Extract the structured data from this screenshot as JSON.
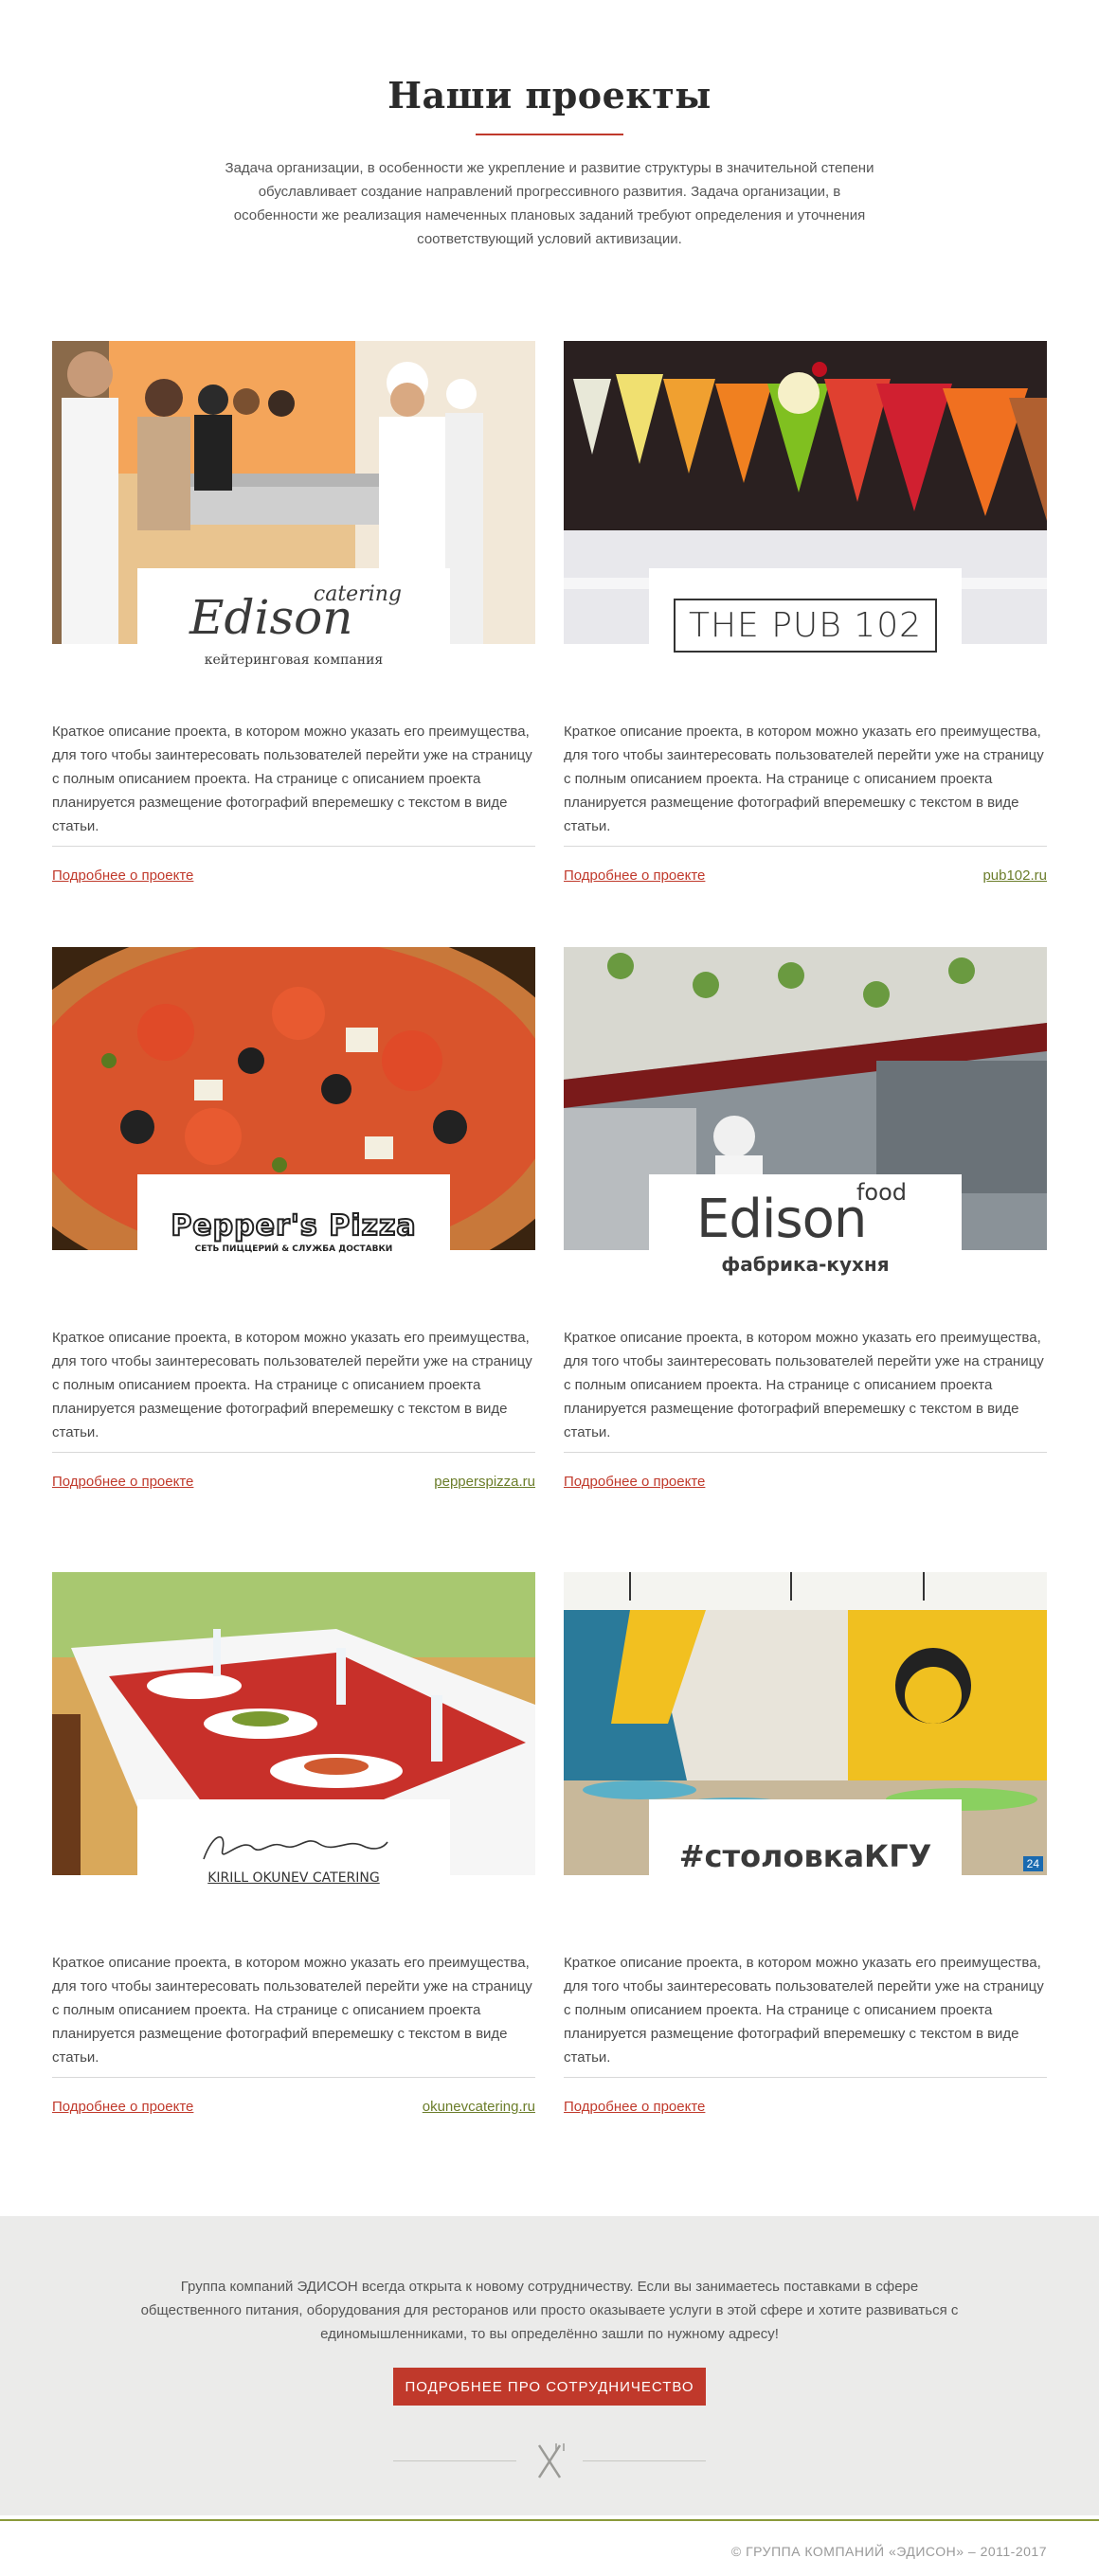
{
  "intro": {
    "title": "Наши проекты",
    "text": "Задача организации, в особенности же укрепление и развитие структуры в значительной степени обуславливает создание направлений прогрессивного развития. Задача организации, в особенности же реализация намеченных плановых заданий требуют определения и уточнения соответствующий условий активизации."
  },
  "projects": [
    {
      "logo_main": "Edison",
      "logo_super": "catering",
      "logo_sub": "кейтеринговая компания",
      "description": "Краткое описание проекта, в котором можно указать его преимущества, для того чтобы заинтересовать пользователей перейти уже на страницу с полным описанием проекта. На странице с описанием проекта планируется размещение фотографий вперемешку с текстом в виде статьи.",
      "more_label": "Подробнее о проекте",
      "site": ""
    },
    {
      "logo_main": "THE PUB 102",
      "description": "Краткое описание проекта, в котором можно указать его преимущества, для того чтобы заинтересовать пользователей перейти уже на страницу с полным описанием проекта. На странице с описанием проекта планируется размещение фотографий вперемешку с текстом в виде статьи.",
      "more_label": "Подробнее о проекте",
      "site": "pub102.ru"
    },
    {
      "logo_main": "Pepper's Pizza",
      "logo_sub": "СЕТЬ ПИЦЦЕРИЙ & СЛУЖБА ДОСТАВКИ",
      "description": "Краткое описание проекта, в котором можно указать его преимущества, для того чтобы заинтересовать пользователей перейти уже на страницу с полным описанием проекта. На странице с описанием проекта планируется размещение фотографий вперемешку с текстом в виде статьи.",
      "more_label": "Подробнее о проекте",
      "site": "pepperspizza.ru"
    },
    {
      "logo_main": "Edison",
      "logo_super": "food",
      "logo_sub": "фабрика-кухня",
      "description": "Краткое описание проекта, в котором можно указать его преимущества, для того чтобы заинтересовать пользователей перейти уже на страницу с полным описанием проекта. На странице с описанием проекта планируется размещение фотографий вперемешку с текстом в виде статьи.",
      "more_label": "Подробнее о проекте",
      "site": ""
    },
    {
      "logo_sub": "KIRILL OKUNEV CATERING",
      "description": "Краткое описание проекта, в котором можно указать его преимущества, для того чтобы заинтересовать пользователей перейти уже на страницу с полным описанием проекта. На странице с описанием проекта планируется размещение фотографий вперемешку с текстом в виде статьи.",
      "more_label": "Подробнее о проекте",
      "site": "okunevcatering.ru"
    },
    {
      "logo_main": "#столовкаКГУ",
      "photo_badge": "24",
      "description": "Краткое описание проекта, в котором можно указать его преимущества, для того чтобы заинтересовать пользователей перейти уже на страницу с полным описанием проекта. На странице с описанием проекта планируется размещение фотографий вперемешку с текстом в виде статьи.",
      "more_label": "Подробнее о проекте",
      "site": ""
    }
  ],
  "cooperation": {
    "text": "Группа компаний ЭДИСОН всегда открыта к новому сотрудничеству. Если вы занимаетесь поставками в сфере общественного питания, оборудования для ресторанов или просто оказываете услуги в этой сфере и хотите развиваться с единомышленниками, то вы определённо зашли по нужному адресу!",
    "button_label": "ПОДРОБНЕЕ ПРО СОТРУДНИЧЕСТВО",
    "icon": "cutlery-icon"
  },
  "footer": {
    "copyright": "© ГРУППА КОМПАНИЙ «ЭДИСОН» – 2011-2017"
  },
  "colors": {
    "accent": "#c0392b",
    "link_green": "#6b7d2a",
    "band": "#ebebea"
  }
}
